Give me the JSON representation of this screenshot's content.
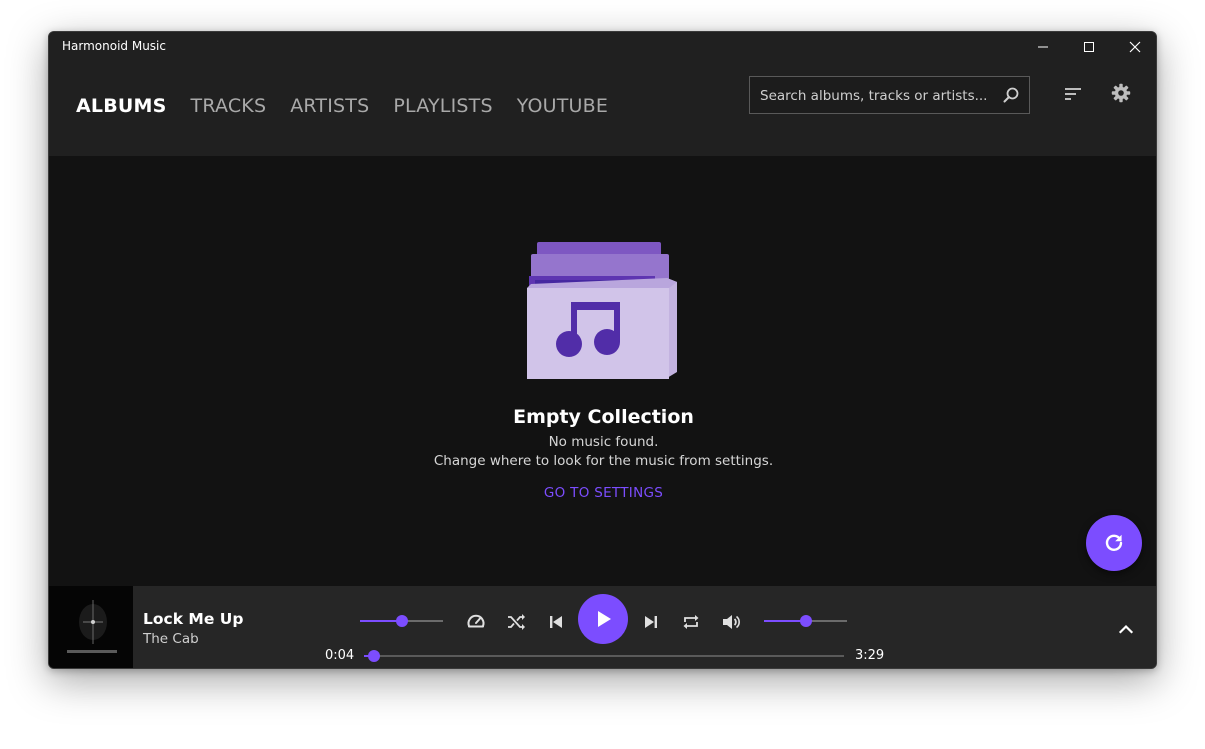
{
  "window": {
    "title": "Harmonoid Music"
  },
  "header": {
    "tabs": [
      {
        "label": "ALBUMS",
        "active": true
      },
      {
        "label": "TRACKS",
        "active": false
      },
      {
        "label": "ARTISTS",
        "active": false
      },
      {
        "label": "PLAYLISTS",
        "active": false
      },
      {
        "label": "YOUTUBE",
        "active": false
      }
    ],
    "search": {
      "placeholder": "Search albums, tracks or artists...",
      "icon": "search-icon"
    },
    "sort_icon": "sort-icon",
    "settings_icon": "gear-icon"
  },
  "content": {
    "empty_title": "Empty Collection",
    "empty_line_1": "No music found.",
    "empty_line_2": "Change where to look for the music from settings.",
    "settings_link": "GO TO SETTINGS",
    "refresh_icon": "refresh-icon"
  },
  "player": {
    "track_title": "Lock Me Up",
    "track_artist": "The Cab",
    "time_current": "0:04",
    "time_total": "3:29",
    "seek_fraction": 0.02,
    "rate_fraction": 0.5,
    "volume_fraction": 0.5,
    "controls": [
      "speed-icon",
      "shuffle-icon",
      "previous-icon",
      "play-icon",
      "next-icon",
      "repeat-icon",
      "volume-icon",
      "chevron-up-icon"
    ]
  },
  "colors": {
    "accent": "#7c4dff",
    "background": "#121212",
    "surface": "#202020",
    "player_bar": "#262626",
    "folder_front": "#d1c4e9",
    "folder_back": "#9575cd",
    "note": "#512da8"
  }
}
